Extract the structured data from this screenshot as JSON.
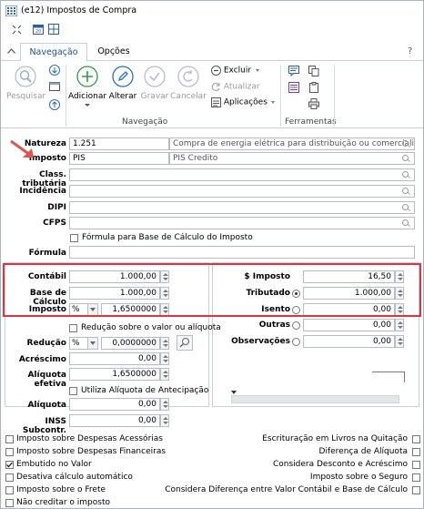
{
  "window": {
    "title": "(e12) Impostos de Compra",
    "help": "?"
  },
  "tabs": [
    {
      "label": "Navegação"
    },
    {
      "label": "Opções"
    }
  ],
  "ribbon": {
    "pesquisar": "Pesquisar",
    "adicionar": "Adicionar",
    "alterar": "Alterar",
    "gravar": "Gravar",
    "cancelar": "Cancelar",
    "excluir": "Excluir",
    "atualizar": "Atualizar",
    "aplicacoes": "Aplicações",
    "group_navegacao": "Navegação",
    "group_ferramentas": "Ferramentas"
  },
  "form": {
    "natureza_label": "Natureza",
    "natureza_value": "1.251",
    "natureza_desc": "Compra de energia elétrica para distribuição ou comercializa",
    "imposto_label": "Imposto",
    "imposto_value": "PIS",
    "imposto_desc": "PIS Credito",
    "class_label": "Class. tributária",
    "incidencia_label": "Incidência",
    "dipi_label": "DIPI",
    "cfps_label": "CFPS",
    "formula_check": "Fórmula para Base de Cálculo do Imposto",
    "formula_label": "Fórmula"
  },
  "values": {
    "contabil_label": "Contábil",
    "contabil_value": "1.000,00",
    "base_label": "Base de Cálculo",
    "base_value": "1.000,00",
    "imposto_label": "Imposto",
    "imposto_unit": "%",
    "imposto_value": "1,6500000",
    "dollar_imposto_label": "$ Imposto",
    "dollar_imposto_value": "16,50",
    "tributado_label": "Tributado",
    "tributado_value": "1.000,00",
    "isento_label": "Isento",
    "isento_value": "0,00",
    "outras_label": "Outras",
    "outras_value": "0,00",
    "observacoes_label": "Observações",
    "observacoes_value": "0,00"
  },
  "reducao": {
    "check_label": "Redução sobre o valor ou alíquota",
    "reducao_label": "Redução",
    "reducao_unit": "%",
    "reducao_value": "0,0000000",
    "acrescimo_label": "Acréscimo",
    "acrescimo_value": "0,00",
    "aliquota_efetiva_label": "Alíquota efetiva",
    "aliquota_efetiva_value": "1,6500000",
    "antecipacao_check": "Utiliza Alíquota de Antecipação",
    "aliquota_label": "Alíquota",
    "aliquota_value": "0,00",
    "inss_label": "INSS Subcontr.",
    "inss_value": "0,00"
  },
  "checks_left": [
    {
      "label": "Imposto sobre Despesas Acessórias",
      "checked": false
    },
    {
      "label": "Imposto sobre Despesas Financeiras",
      "checked": false
    },
    {
      "label": "Embutido no Valor",
      "checked": true
    },
    {
      "label": "Desativa cálculo automático",
      "checked": false
    },
    {
      "label": "Imposto sobre o Frete",
      "checked": false
    },
    {
      "label": "Não creditar o imposto",
      "checked": false
    }
  ],
  "checks_right": [
    {
      "label": "Escrituração em Livros na Quitação",
      "checked": false
    },
    {
      "label": "Diferença de Alíquota",
      "checked": false
    },
    {
      "label": "Considera Desconto e Acréscimo",
      "checked": false
    },
    {
      "label": "Imposto sobre o Seguro",
      "checked": false
    },
    {
      "label": "Considera Diferença entre Valor Contábil e Base de Cálculo",
      "checked": false
    }
  ],
  "colors": {
    "accent": "#1f4d86",
    "highlight": "#e0343e",
    "arrow": "#e0534f"
  }
}
